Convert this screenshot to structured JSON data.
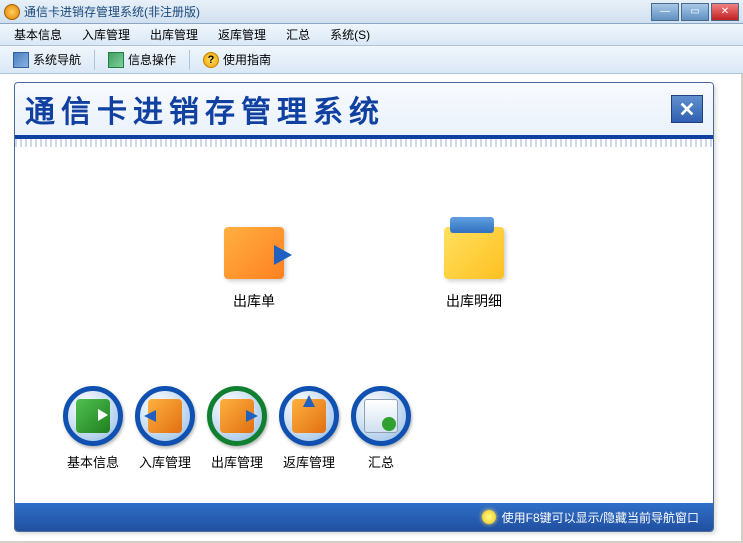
{
  "window": {
    "title": "通信卡进销存管理系统(非注册版)"
  },
  "menu": {
    "basic": "基本信息",
    "stockin": "入库管理",
    "stockout": "出库管理",
    "return": "返库管理",
    "summary": "汇总",
    "system": "系统(S)"
  },
  "toolbar": {
    "nav": "系统导航",
    "info": "信息操作",
    "guide": "使用指南",
    "help_glyph": "?"
  },
  "inner": {
    "title": "通信卡进销存管理系统",
    "main_icons": {
      "stock_out": "出库单",
      "stock_detail": "出库明细"
    },
    "circles": {
      "basic": "基本信息",
      "stockin": "入库管理",
      "stockout": "出库管理",
      "return": "返库管理",
      "summary": "汇总"
    },
    "status": "使用F8键可以显示/隐藏当前导航窗口"
  }
}
